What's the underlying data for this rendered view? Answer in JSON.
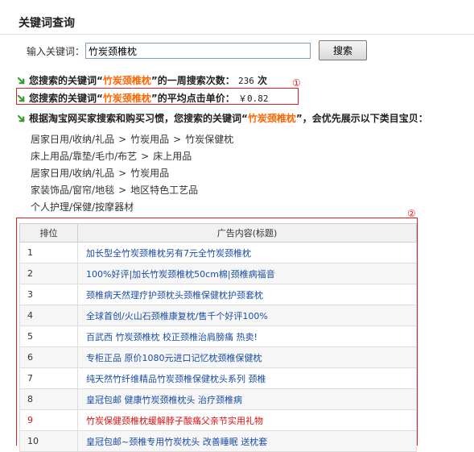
{
  "page": {
    "title": "关键词查询"
  },
  "search": {
    "label": "输入关键词：",
    "value": "竹炭颈椎枕",
    "button": "搜索"
  },
  "stats": {
    "weekly_prefix": "您搜索的关键词“",
    "weekly_keyword": "竹炭颈椎枕",
    "weekly_suffix": "”的一周搜索次数：",
    "weekly_value": "236",
    "weekly_unit": "次",
    "price_prefix": "您搜索的关键词“",
    "price_keyword": "竹炭颈椎枕",
    "price_suffix": "”的平均点击单价：",
    "price_value": "￥0.82",
    "category_prefix": "根据淘宝网买家搜索和购买习惯，您搜索的关键词“",
    "category_keyword": "竹炭颈椎枕",
    "category_suffix": "”，会优先展示以下类目宝贝："
  },
  "markers": {
    "one": "①",
    "two": "②"
  },
  "categories": [
    [
      "居家日用/收纳/礼品",
      "竹炭用品",
      "竹炭保健枕"
    ],
    [
      "床上用品/靠垫/毛巾/布艺",
      "床上用品"
    ],
    [
      "居家日用/收纳/礼品",
      "竹炭用品"
    ],
    [
      "家装饰品/窗帘/地毯",
      "地区特色工艺品"
    ],
    [
      "个人护理/保健/按摩器材"
    ]
  ],
  "category_separator": ">",
  "table": {
    "headers": [
      "排位",
      "广告内容(标题)"
    ],
    "rows": [
      {
        "rank": "1",
        "title": "加长型全竹炭颈椎枕另有7元全竹炭颈椎枕"
      },
      {
        "rank": "2",
        "title": "100%好评|加长竹炭颈椎枕50cm棉|颈椎病福音"
      },
      {
        "rank": "3",
        "title": "颈椎病天然理疗护颈枕头颈椎保健枕护颈套枕"
      },
      {
        "rank": "4",
        "title": "全球首创/火山石颈椎康复枕/售千个好评100%"
      },
      {
        "rank": "5",
        "title": "百武西 竹炭颈椎枕 校正颈椎治肩膀痛 热卖!"
      },
      {
        "rank": "6",
        "title": "专柜正品 原价1080元进口记忆枕颈椎保健枕"
      },
      {
        "rank": "7",
        "title": "纯天然竹纤维精品竹炭颈椎保健枕头系列 颈椎"
      },
      {
        "rank": "8",
        "title": "皇冠包邮 健康竹炭颈椎枕头 治疗颈椎病"
      },
      {
        "rank": "9",
        "title": "竹炭保健颈椎枕缓解脖子酸痛父亲节实用礼物"
      },
      {
        "rank": "10",
        "title": "皇冠包邮~颈椎专用竹炭枕头 改善睡眠 送枕套"
      }
    ]
  },
  "colors": {
    "keyword": "#ff6600",
    "annotation": "#e02020",
    "link": "#1a4ca8",
    "hot": "#dd1111",
    "arrow": "#3a9b2c"
  },
  "icons": {
    "bullet": "green-arrow-icon"
  }
}
